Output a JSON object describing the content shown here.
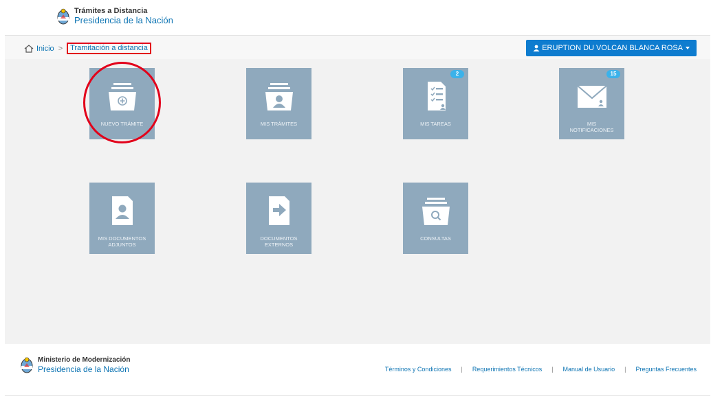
{
  "header": {
    "title": "Trámites a Distancia",
    "subtitle": "Presidencia de la Nación"
  },
  "breadcrumb": {
    "home": "Inicio",
    "separator": ">",
    "current": "Tramitación a distancia"
  },
  "user": {
    "name": "ERUPTION DU VOLCAN BLANCA ROSA"
  },
  "tiles": [
    {
      "label": "NUEVO TRÁMITE",
      "icon": "new-folder-icon"
    },
    {
      "label": "MIS TRÁMITES",
      "icon": "user-folder-icon"
    },
    {
      "label": "MIS TAREAS",
      "icon": "tasks-icon",
      "badge": "2"
    },
    {
      "label": "MIS NOTIFICACIONES",
      "icon": "envelope-icon",
      "badge": "15"
    },
    {
      "label": "MIS DOCUMENTOS ADJUNTOS",
      "icon": "user-document-icon"
    },
    {
      "label": "DOCUMENTOS EXTERNOS",
      "icon": "external-document-icon"
    },
    {
      "label": "CONSULTAS",
      "icon": "search-folder-icon"
    }
  ],
  "footer": {
    "org": "Ministerio de Modernización",
    "subtitle": "Presidencia de la Nación",
    "links": [
      "Términos y Condiciones",
      "Requerimientos Técnicos",
      "Manual de Usuario",
      "Preguntas Frecuentes"
    ]
  },
  "colors": {
    "tile": "#8fa9bd",
    "primary": "#0e7ccf",
    "badge": "#3bb2ea",
    "highlight": "#e2001a"
  }
}
